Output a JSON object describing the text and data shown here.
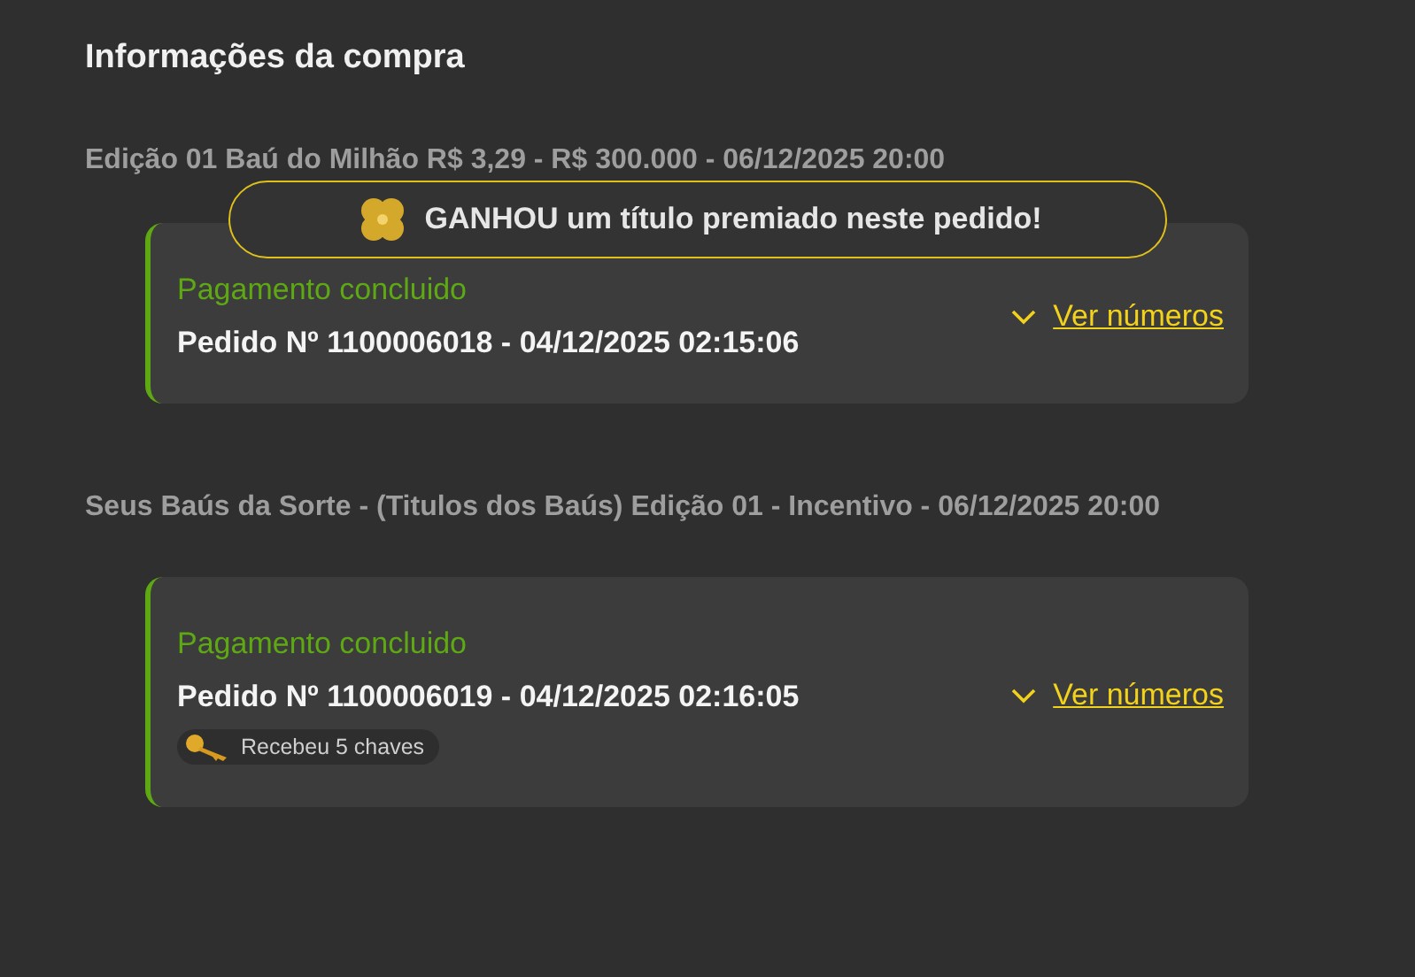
{
  "title": "Informações da compra",
  "sections": [
    {
      "heading": "Edição 01 Baú do Milhão R$ 3,29 - R$ 300.000 - 06/12/2025 20:00",
      "prize_badge": "GANHOU um título premiado neste pedido!",
      "status": "Pagamento concluido",
      "order": "Pedido Nº 1100006018 - 04/12/2025 02:15:06",
      "link": "Ver números"
    },
    {
      "heading": "Seus Baús da Sorte - (Titulos dos Baús) Edição 01 - Incentivo - 06/12/2025 20:00",
      "status": "Pagamento concluido",
      "order": "Pedido Nº 1100006019 - 04/12/2025 02:16:05",
      "link": "Ver números",
      "reward": "Recebeu 5 chaves"
    }
  ]
}
